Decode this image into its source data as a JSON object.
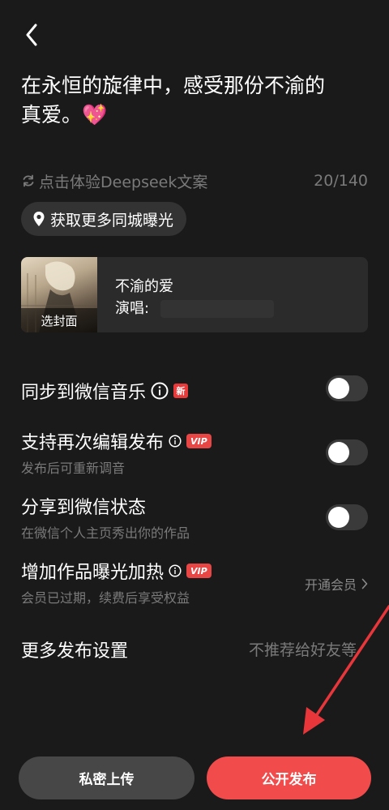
{
  "caption": {
    "line1": "在永恒的旋律中，感受那份不渝的",
    "line2": "真爱。💖"
  },
  "ai_suggest": {
    "label": "点击体验Deepseek文案",
    "icon": "refresh-icon"
  },
  "char_counter": "20/140",
  "location": {
    "label": "获取更多同城曝光",
    "icon": "location-pin-icon"
  },
  "song": {
    "cover_label": "选封面",
    "title": "不渝的爱",
    "artist_label": "演唱:"
  },
  "settings": {
    "sync_wechat": {
      "title": "同步到微信音乐",
      "badge": "新",
      "enabled": false
    },
    "re_edit": {
      "title": "支持再次编辑发布",
      "badge": "VIP",
      "subtitle": "发布后可重新调音",
      "enabled": false
    },
    "share_status": {
      "title": "分享到微信状态",
      "subtitle": "在微信个人主页秀出你的作品",
      "enabled": false
    },
    "boost": {
      "title": "增加作品曝光加热",
      "badge": "VIP",
      "subtitle": "会员已过期，续费后享受权益",
      "action": "开通会员"
    },
    "more": {
      "title": "更多发布设置",
      "value": "不推荐给好友等"
    }
  },
  "buttons": {
    "private": "私密上传",
    "public": "公开发布"
  },
  "colors": {
    "background": "#1a1a1a",
    "accent": "#f24b4b",
    "muted_text": "#7a7a7a",
    "annotation_arrow": "#e8363b"
  }
}
